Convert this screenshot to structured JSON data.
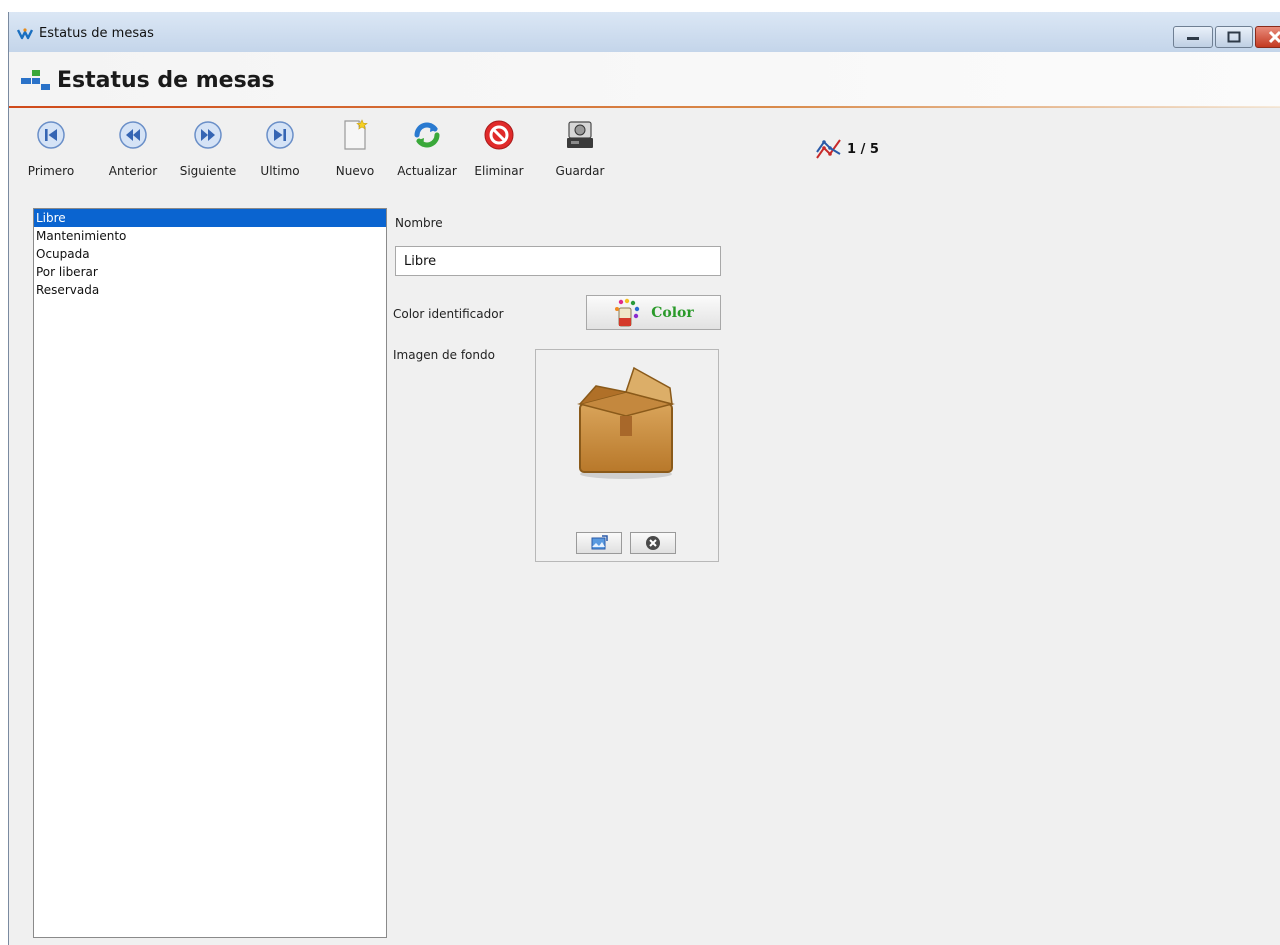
{
  "window": {
    "title": "Estatus de mesas"
  },
  "header": {
    "title": "Estatus de mesas"
  },
  "toolbar": {
    "first_label": "Primero",
    "previous_label": "Anterior",
    "next_label": "Siguiente",
    "last_label": "Ultimo",
    "new_label": "Nuevo",
    "refresh_label": "Actualizar",
    "delete_label": "Eliminar",
    "save_label": "Guardar"
  },
  "counter": {
    "text": "1 / 5"
  },
  "list": {
    "items": [
      "Libre",
      "Mantenimiento",
      "Ocupada",
      "Por liberar",
      "Reservada"
    ],
    "selected_index": 0
  },
  "form": {
    "name_label": "Nombre",
    "name_value": "Libre",
    "color_label": "Color identificador",
    "color_button_label": "Color",
    "image_label": "Imagen de fondo"
  },
  "colors": {
    "selection": "#0a64d0",
    "header_accent": "#d04a1a",
    "color_button_text": "#2a9a2a"
  },
  "icons": {
    "first": "skip-first-icon",
    "previous": "rewind-icon",
    "next": "fast-forward-icon",
    "last": "skip-last-icon",
    "new": "new-document-icon",
    "refresh": "refresh-icon",
    "delete": "delete-icon",
    "save": "save-disk-icon",
    "counter": "chart-line-icon",
    "image_placeholder": "cardboard-box-icon",
    "load_image": "open-image-icon",
    "clear_image": "clear-icon"
  }
}
